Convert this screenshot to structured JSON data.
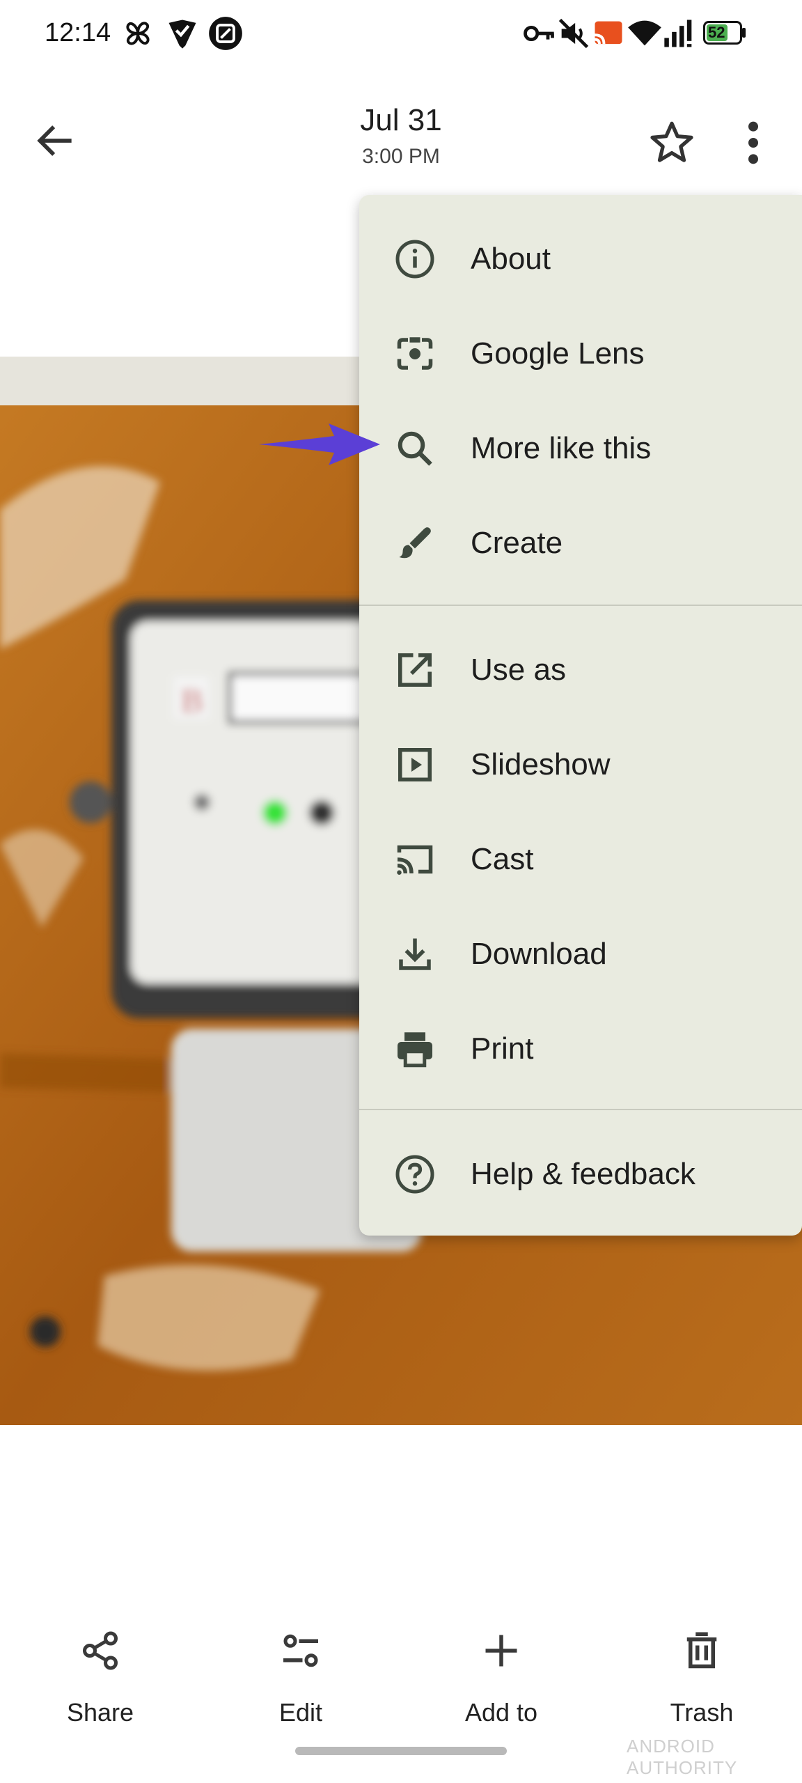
{
  "status_bar": {
    "time": "12:14",
    "battery": "52"
  },
  "header": {
    "title": "Jul 31",
    "subtitle": "3:00 PM"
  },
  "menu": {
    "items": [
      {
        "label": "About",
        "icon": "info-icon"
      },
      {
        "label": "Google Lens",
        "icon": "lens-icon"
      },
      {
        "label": "More like this",
        "icon": "search-icon"
      },
      {
        "label": "Create",
        "icon": "brush-icon"
      },
      {
        "label": "Use as",
        "icon": "open-external-icon"
      },
      {
        "label": "Slideshow",
        "icon": "slideshow-icon"
      },
      {
        "label": "Cast",
        "icon": "cast-icon"
      },
      {
        "label": "Download",
        "icon": "download-icon"
      },
      {
        "label": "Print",
        "icon": "print-icon"
      },
      {
        "label": "Help & feedback",
        "icon": "help-icon"
      }
    ]
  },
  "bottom_bar": {
    "items": [
      {
        "label": "Share",
        "icon": "share-icon"
      },
      {
        "label": "Edit",
        "icon": "edit-sliders-icon"
      },
      {
        "label": "Add to",
        "icon": "plus-icon"
      },
      {
        "label": "Trash",
        "icon": "trash-icon"
      }
    ]
  },
  "watermark": "ANDROID AUTHORITY",
  "colors": {
    "menu_bg": "#e9ebe0",
    "arrow": "#5b3fd6",
    "icon": "#3f4a3f"
  }
}
